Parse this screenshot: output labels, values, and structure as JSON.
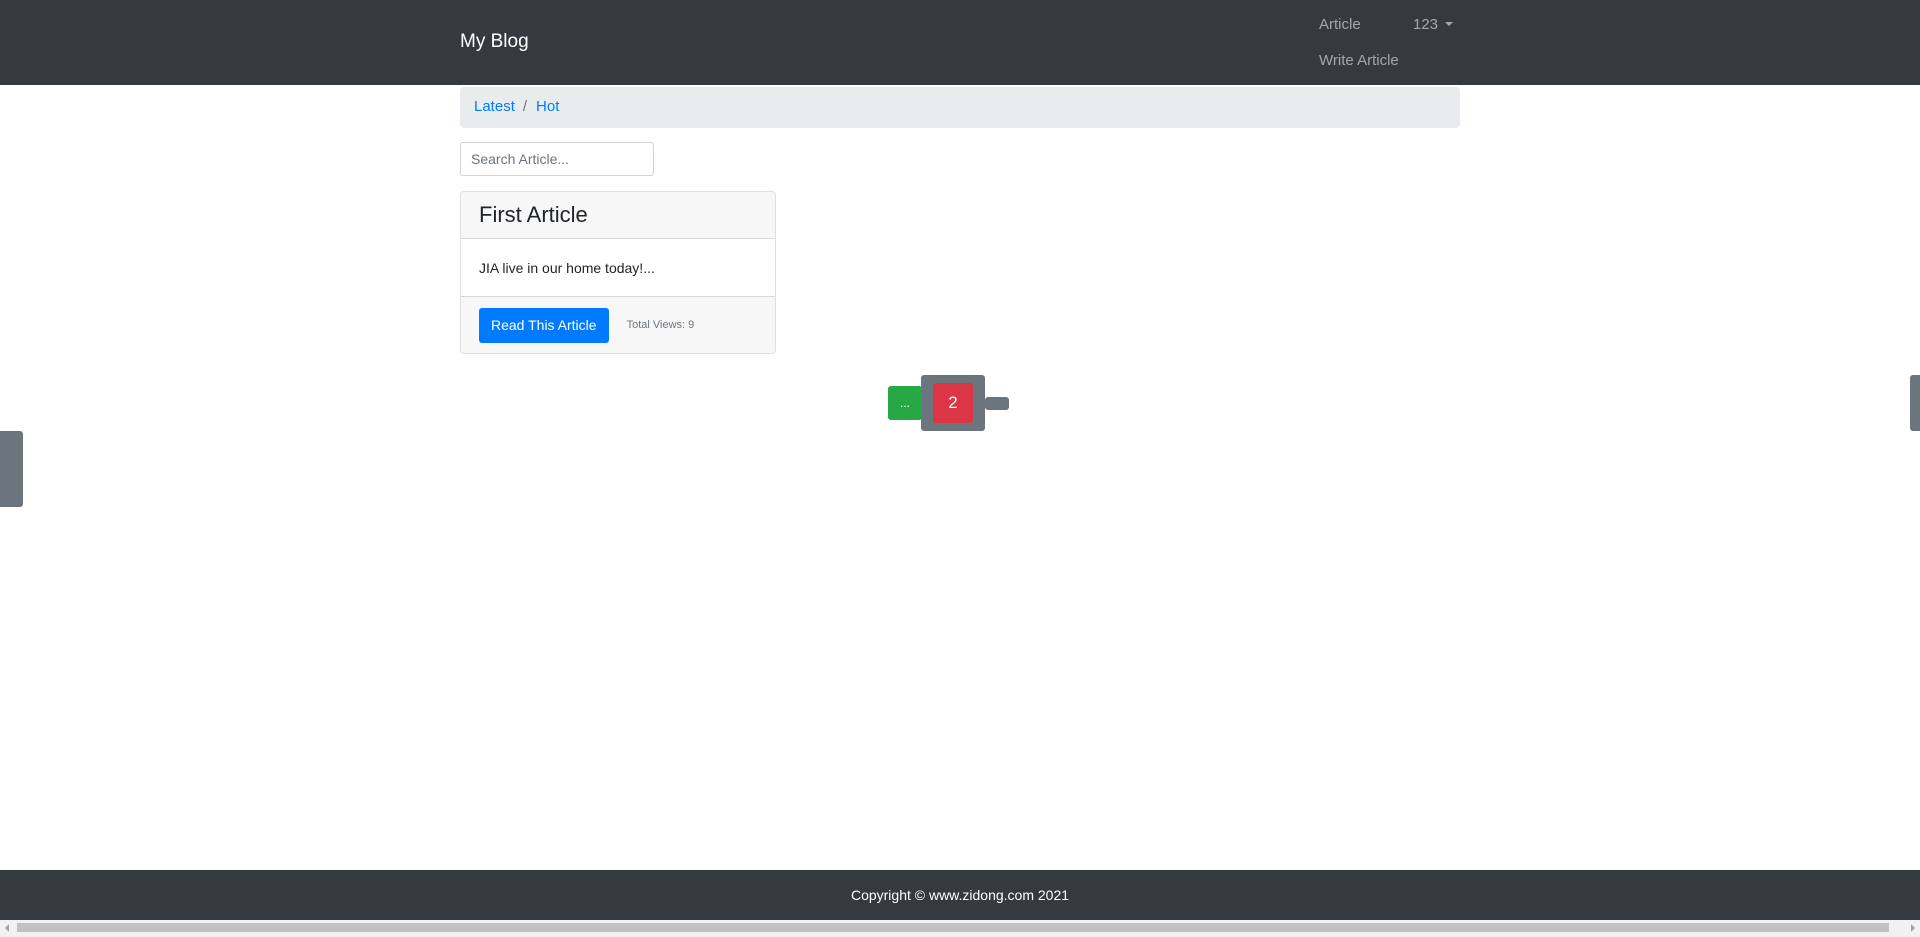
{
  "navbar": {
    "brand": "My Blog",
    "article_link": "Article",
    "user_menu": "123",
    "write_article_link": "Write Article"
  },
  "breadcrumb": {
    "items": [
      "Latest",
      "Hot"
    ],
    "separator": "/"
  },
  "search": {
    "placeholder": "Search Article..."
  },
  "articles": [
    {
      "title": "First Article",
      "excerpt": "JIA live in our home today!...",
      "read_button": "Read This Article",
      "views_label": "Total Views: 9"
    }
  ],
  "pagination": {
    "prev_label": "...",
    "current_page": "2"
  },
  "footer": {
    "copyright": "Copyright © www.zidong.com 2021"
  },
  "colors": {
    "navbar_bg": "#343a40",
    "primary": "#007bff",
    "success": "#28a745",
    "danger": "#dc3545",
    "secondary": "#6c757d"
  }
}
